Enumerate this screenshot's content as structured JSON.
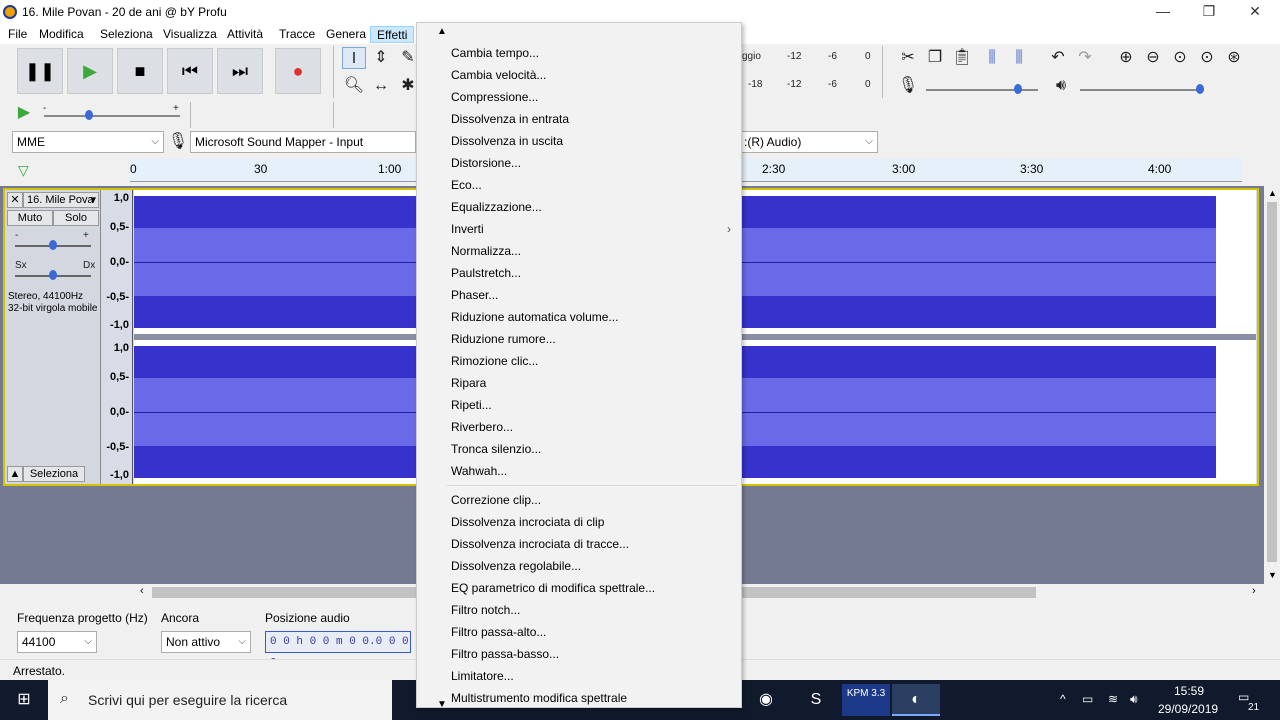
{
  "window": {
    "title": "16. Mile Povan  - 20 de ani @ bY Profu",
    "minimize": "—",
    "restore": "❐",
    "close": "✕"
  },
  "menubar": [
    "File",
    "Modifica",
    "Seleziona",
    "Visualizza",
    "Attività",
    "Tracce",
    "Genera",
    "Effetti"
  ],
  "active_menu": "Effetti",
  "transport": {
    "pause_icon": "pause-icon",
    "play_icon": "play-icon",
    "stop_icon": "stop-icon",
    "skip_start_icon": "skip-start-icon",
    "skip_end_icon": "skip-end-icon",
    "record_icon": "record-icon"
  },
  "meters": {
    "rec_scale": [
      "ggio",
      "-12",
      "-6",
      "0"
    ],
    "play_scale": [
      "-18",
      "-12",
      "-6",
      "0"
    ]
  },
  "device": {
    "host": "MME",
    "input": "Microsoft Sound Mapper - Input",
    "output_partial": ":(R) Audio)"
  },
  "timeline": {
    "labels_left": [
      "0",
      "30",
      "1:00"
    ],
    "labels_right": [
      "2:30",
      "3:00",
      "3:30",
      "4:00"
    ]
  },
  "track": {
    "name": "16. Mile Pova",
    "close": "✕",
    "mute": "Muto",
    "solo": "Solo",
    "pan_left": "Sx",
    "pan_right": "Dx",
    "gain_minus": "-",
    "gain_plus": "+",
    "info_line1": "Stereo, 44100Hz",
    "info_line2": "32-bit virgola mobile",
    "select": "Seleziona",
    "scale": [
      "1,0",
      "0,5-",
      "0,0-",
      "-0,5-",
      "-1,0"
    ]
  },
  "selection_toolbar": {
    "rate_label": "Frequenza progetto (Hz)",
    "rate_value": "44100",
    "snap_label": "Ancora",
    "snap_value": "Non attivo",
    "pos_label": "Posizione audio",
    "pos_value": "0 0 h 0 0 m 0 0.0 0 0 s"
  },
  "status": "Arrestato.",
  "taskbar": {
    "search_placeholder": "Scrivi qui per eseguire la ricerca",
    "time": "15:59",
    "date": "29/09/2019",
    "notif_count": "21",
    "kpm_label": "KPM 3.3"
  },
  "effects_menu": {
    "group1": [
      "Cambia tempo...",
      "Cambia velocità...",
      "Compressione...",
      "Dissolvenza in entrata",
      "Dissolvenza in uscita",
      "Distorsione...",
      "Eco...",
      "Equalizzazione...",
      "Inverti",
      "Normalizza...",
      "Paulstretch...",
      "Phaser...",
      "Riduzione automatica volume...",
      "Riduzione rumore...",
      "Rimozione clic...",
      "Ripara",
      "Ripeti...",
      "Riverbero...",
      "Tronca silenzio...",
      "Wahwah..."
    ],
    "group2": [
      "Correzione clip...",
      "Dissolvenza incrociata di clip",
      "Dissolvenza incrociata di tracce...",
      "Dissolvenza regolabile...",
      "EQ parametrico di modifica spettrale...",
      "Filtro notch...",
      "Filtro passa-alto...",
      "Filtro passa-basso...",
      "Limitatore...",
      "Multistrumento modifica spettrale"
    ],
    "submenu_item": "Inverti",
    "submenu_arrow": "›",
    "scroll_up": "▲",
    "scroll_down": "▼"
  }
}
